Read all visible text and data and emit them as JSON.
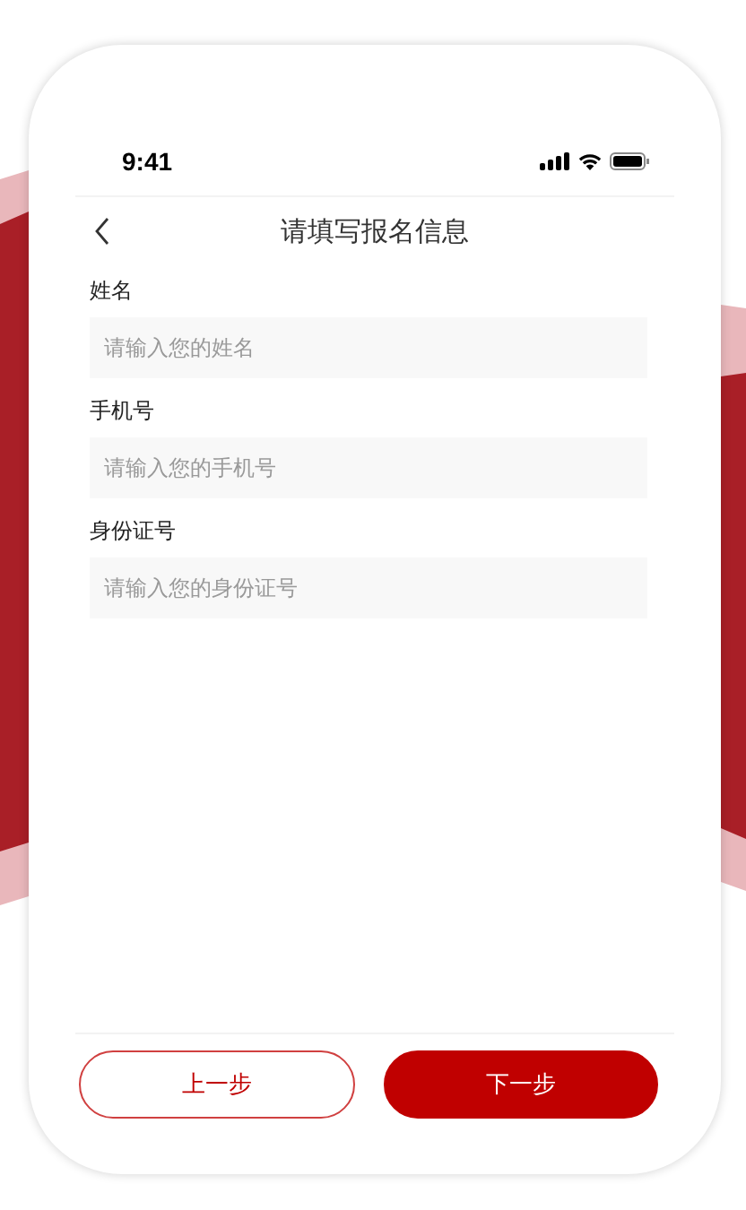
{
  "status_bar": {
    "time": "9:41"
  },
  "nav": {
    "title": "请填写报名信息"
  },
  "fields": [
    {
      "label": "姓名",
      "placeholder": "请输入您的姓名"
    },
    {
      "label": "手机号",
      "placeholder": "请输入您的手机号"
    },
    {
      "label": "身份证号",
      "placeholder": "请输入您的身份证号"
    }
  ],
  "buttons": [
    {
      "label": "上一步",
      "primary": false
    },
    {
      "label": "下一步",
      "primary": true
    }
  ]
}
